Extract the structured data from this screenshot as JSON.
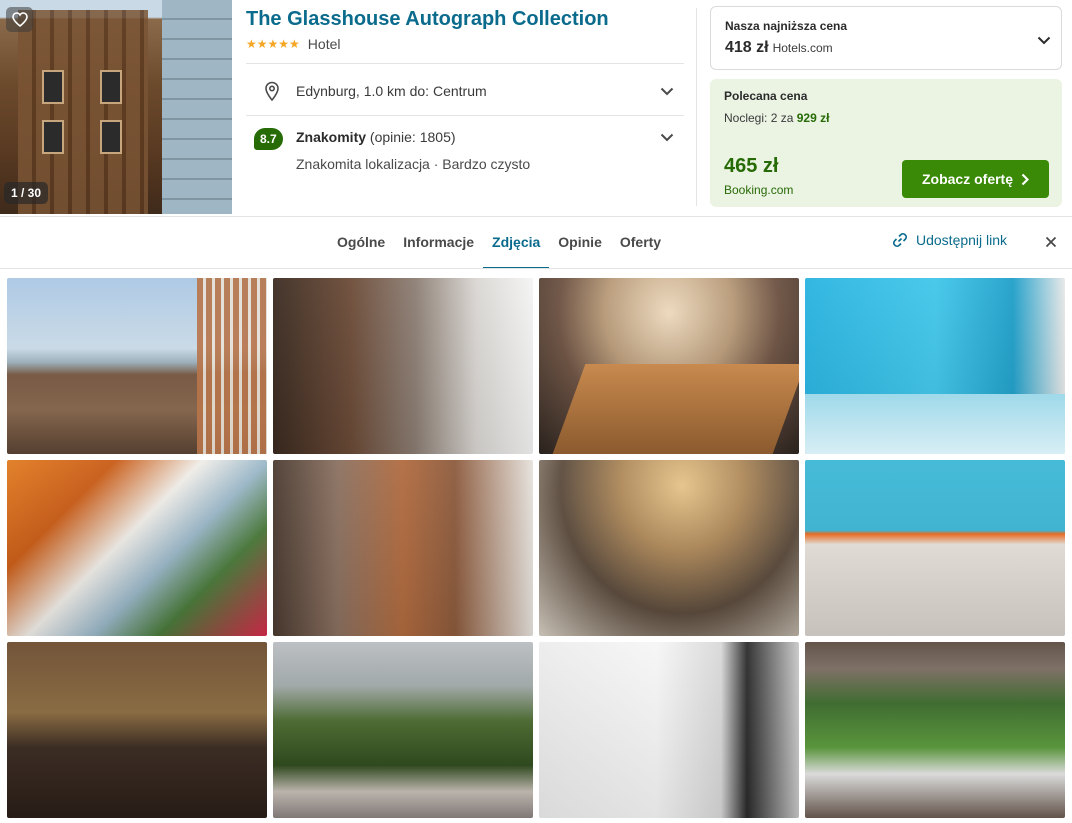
{
  "hotel": {
    "name": "The Glasshouse Autograph Collection",
    "stars": "★★★★★",
    "type": "Hotel",
    "photo_counter": "1 / 30",
    "location": "Edynburg, 1.0 km do: Centrum",
    "rating": {
      "score": "8.7",
      "label": "Znakomity",
      "reviews": "(opinie: 1805)",
      "highlights": "Znakomita lokalizacja · Bardzo czysto"
    }
  },
  "lowest_price": {
    "label": "Nasza najniższa cena",
    "price": "418 zł",
    "provider": "Hotels.com"
  },
  "recommended": {
    "label": "Polecana cena",
    "nights_text": "Noclegi: 2 za",
    "nights_total": "929 zł",
    "price": "465 zł",
    "provider": "Booking.com",
    "cta": "Zobacz ofertę"
  },
  "tabs": [
    {
      "label": "Ogólne"
    },
    {
      "label": "Informacje"
    },
    {
      "label": "Zdjęcia"
    },
    {
      "label": "Opinie"
    },
    {
      "label": "Oferty"
    }
  ],
  "active_tab": "Zdjęcia",
  "share_label": "Udostępnij link",
  "colors": {
    "brand_blue": "#0b6b8c",
    "rating_green": "#276b06",
    "cta_green": "#3a8a07",
    "star_orange": "#f5a623"
  },
  "icons": [
    "heart-icon",
    "map-pin-icon",
    "chevron-down-icon",
    "chevron-right-icon",
    "link-icon",
    "close-icon"
  ]
}
